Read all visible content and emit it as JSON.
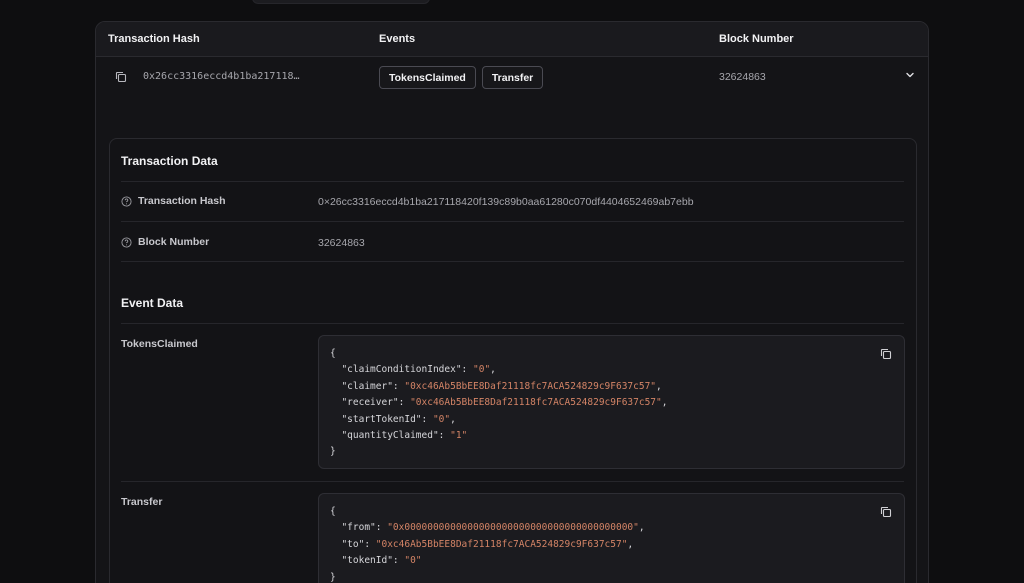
{
  "table": {
    "columns": [
      "Transaction Hash",
      "Events",
      "Block Number"
    ],
    "row": {
      "hash_short": "0x26cc3316eccd4b1ba217118…",
      "events": [
        "TokensClaimed",
        "Transfer"
      ],
      "block_number": "32624863"
    }
  },
  "details": {
    "transaction_data_title": "Transaction Data",
    "fields": [
      {
        "label": "Transaction Hash",
        "value": "0×26cc3316eccd4b1ba217118420f139c89b0aa61280c070df4404652469ab7ebb"
      },
      {
        "label": "Block Number",
        "value": "32624863"
      }
    ],
    "event_data_title": "Event Data",
    "events": [
      {
        "name": "TokensClaimed",
        "lines": [
          {
            "key": "\"claimConditionIndex\"",
            "value": "\"0\"",
            "comma": true
          },
          {
            "key": "\"claimer\"",
            "value": "\"0xc46Ab5BbEE8Daf21118fc7ACA524829c9F637c57\"",
            "comma": true
          },
          {
            "key": "\"receiver\"",
            "value": "\"0xc46Ab5BbEE8Daf21118fc7ACA524829c9F637c57\"",
            "comma": true
          },
          {
            "key": "\"startTokenId\"",
            "value": "\"0\"",
            "comma": true
          },
          {
            "key": "\"quantityClaimed\"",
            "value": "\"1\"",
            "comma": false
          }
        ]
      },
      {
        "name": "Transfer",
        "lines": [
          {
            "key": "\"from\"",
            "value": "\"0x0000000000000000000000000000000000000000\"",
            "comma": true
          },
          {
            "key": "\"to\"",
            "value": "\"0xc46Ab5BbEE8Daf21118fc7ACA524829c9F637c57\"",
            "comma": true
          },
          {
            "key": "\"tokenId\"",
            "value": "\"0\"",
            "comma": false
          }
        ]
      }
    ]
  },
  "icons": {
    "copy": "copy-icon",
    "chevron": "chevron-down-icon",
    "help": "help-circle-icon"
  },
  "colors": {
    "background": "#0e0e10",
    "string": "#d48466"
  }
}
